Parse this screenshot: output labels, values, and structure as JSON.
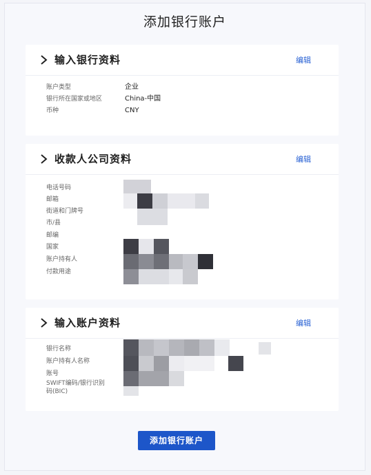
{
  "page": {
    "title": "添加银行账户"
  },
  "bank_info": {
    "title": "输入银行资料",
    "edit_label": "编辑",
    "fields": [
      {
        "label": "账户类型",
        "value": "企业"
      },
      {
        "label": "银行所在国家或地区",
        "value": "China-中国"
      },
      {
        "label": "币种",
        "value": "CNY"
      }
    ]
  },
  "payee_company": {
    "title": "收款人公司资料",
    "edit_label": "编辑",
    "fields": [
      {
        "label": "电话号码"
      },
      {
        "label": "邮箱"
      },
      {
        "label": "街道和门牌号"
      },
      {
        "label": "市/县"
      },
      {
        "label": "邮编"
      },
      {
        "label": "国家"
      },
      {
        "label": "账户持有人"
      },
      {
        "label": "付款用途"
      }
    ]
  },
  "account_info": {
    "title": "输入账户资料",
    "edit_label": "编辑",
    "fields": [
      {
        "label": "银行名称"
      },
      {
        "label": "账户持有人名称"
      },
      {
        "label": "账号"
      },
      {
        "label": "SWIFT编码/银行识别码(BIC)",
        "label_line1": "SWIFT编码/银行识别",
        "label_line2": "码(BIC)"
      }
    ]
  },
  "footer": {
    "submit_label": "添加银行账户"
  },
  "colors": {
    "accent": "#1d56c9",
    "link": "#2a62d4"
  }
}
